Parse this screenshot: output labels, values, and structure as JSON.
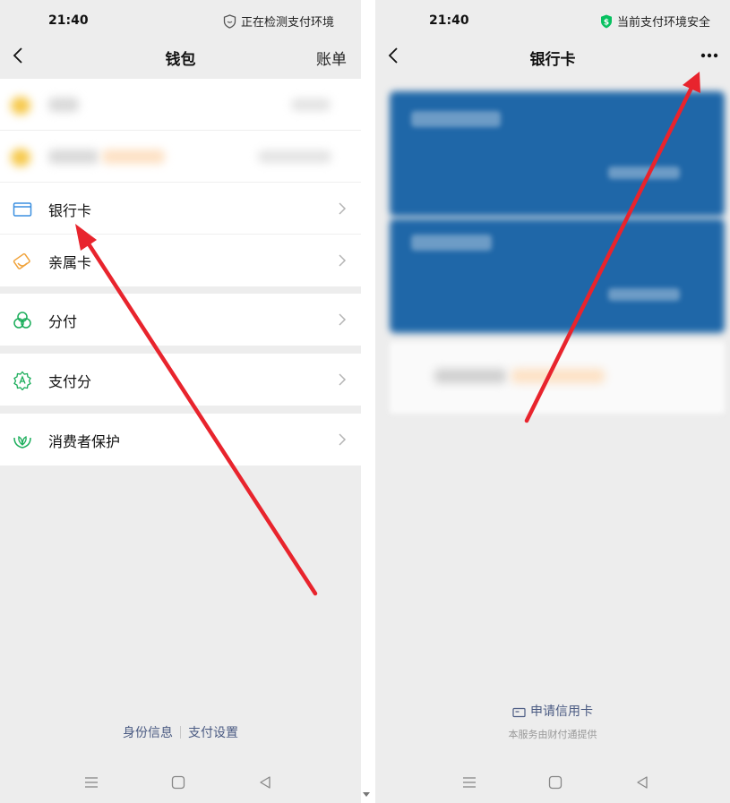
{
  "left_screen": {
    "status": {
      "time": "21:40",
      "env_text": "正在检测支付环境"
    },
    "header": {
      "title": "钱包",
      "bill_label": "账单"
    },
    "menu_items": [
      {
        "label": "银行卡",
        "icon": "bank-card-icon"
      },
      {
        "label": "亲属卡",
        "icon": "family-card-icon"
      },
      {
        "label": "分付",
        "icon": "fenfu-icon"
      },
      {
        "label": "支付分",
        "icon": "pay-score-icon"
      },
      {
        "label": "消费者保护",
        "icon": "consumer-protection-icon"
      }
    ],
    "footer": {
      "identity_label": "身份信息",
      "settings_label": "支付设置"
    }
  },
  "right_screen": {
    "status": {
      "time": "21:40",
      "env_text": "当前支付环境安全"
    },
    "header": {
      "title": "银行卡"
    },
    "apply_credit_label": "申请信用卡",
    "provided_by": "本服务由财付通提供"
  },
  "colors": {
    "accent_green": "#07c160",
    "link_blue": "#4a5a82",
    "card_blue": "#1f67a8",
    "annotation_red": "#e8242d"
  }
}
